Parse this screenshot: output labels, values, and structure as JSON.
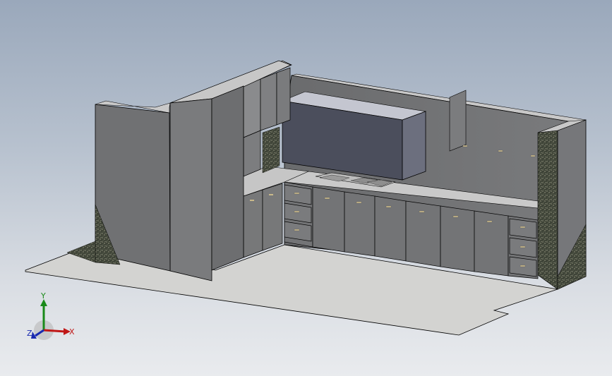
{
  "viewport": {
    "background_top": "#9aa8bb",
    "background_bottom": "#e9ebee"
  },
  "model": {
    "colors": {
      "floor": "#d2d2d0",
      "wall_face": "#6e6f71",
      "wall_top": "#c7c7c7",
      "cabinet_face": "#707173",
      "cabinet_light": "#8a8b8d",
      "hood": "#4c4f5d",
      "counter": "#c9c9c9",
      "granite": "#3f4438",
      "edge": "#000000"
    }
  },
  "triad": {
    "x_label": "X",
    "y_label": "Y",
    "z_label": "Z",
    "x_color": "#c01818",
    "y_color": "#1a8a1a",
    "z_color": "#1a2ab0"
  }
}
